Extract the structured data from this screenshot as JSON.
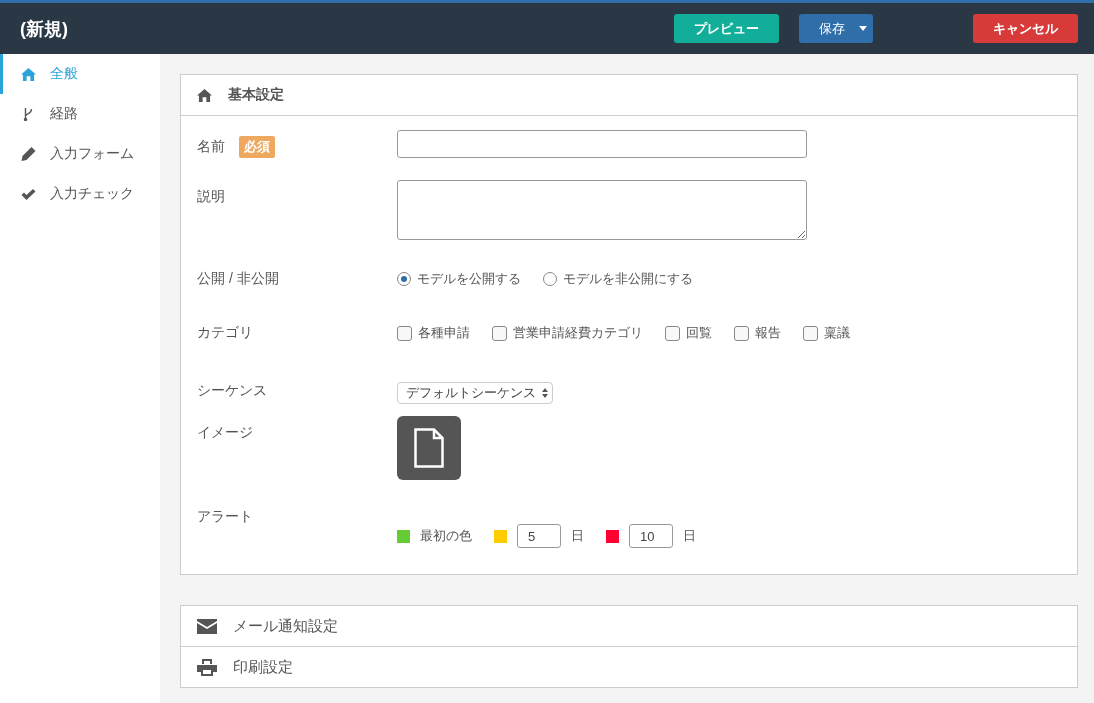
{
  "header": {
    "title": "(新規)",
    "buttons": [
      {
        "label": "プレビュー",
        "kind": "preview"
      },
      {
        "label": "保存",
        "kind": "save"
      },
      {
        "label": "キャンセル",
        "kind": "cancel"
      }
    ]
  },
  "sidebar": {
    "items": [
      {
        "label": "全般",
        "selected": true
      },
      {
        "label": "経路",
        "selected": false
      },
      {
        "label": "入力フォーム",
        "selected": false
      },
      {
        "label": "入力チェック",
        "selected": false
      }
    ]
  },
  "basic_panel": {
    "title": "基本設定",
    "fields": [
      {
        "kind": "text",
        "label": "名前",
        "badge": "必須"
      },
      {
        "kind": "textarea",
        "label": "説明"
      },
      {
        "kind": "radio",
        "label": "公開 / 非公開",
        "options": [
          {
            "label": "モデルを公開する",
            "selected": true
          },
          {
            "label": "モデルを非公開にする",
            "selected": false
          }
        ]
      },
      {
        "kind": "checkbox",
        "label": "カテゴリ",
        "options": [
          {
            "label": "各種申請",
            "checked": false
          },
          {
            "label": "営業申請経費カテゴリ",
            "checked": false
          },
          {
            "label": "回覧",
            "checked": false
          },
          {
            "label": "報告",
            "checked": false
          },
          {
            "label": "稟議",
            "checked": false
          }
        ]
      },
      {
        "kind": "select",
        "label": "シーケンス",
        "value": "デフォルトシーケンス"
      },
      {
        "kind": "image",
        "label": "イメージ"
      },
      {
        "kind": "alert",
        "label": "アラート",
        "items": [
          {
            "color": "#66cc33",
            "label": "最初の色"
          },
          {
            "color": "#ffcc00",
            "value": "5",
            "unit": "日"
          },
          {
            "color": "#ff0033",
            "value": "10",
            "unit": "日"
          }
        ]
      }
    ]
  },
  "collapsed_panels": [
    {
      "title": "メール通知設定"
    },
    {
      "title": "印刷設定"
    }
  ]
}
